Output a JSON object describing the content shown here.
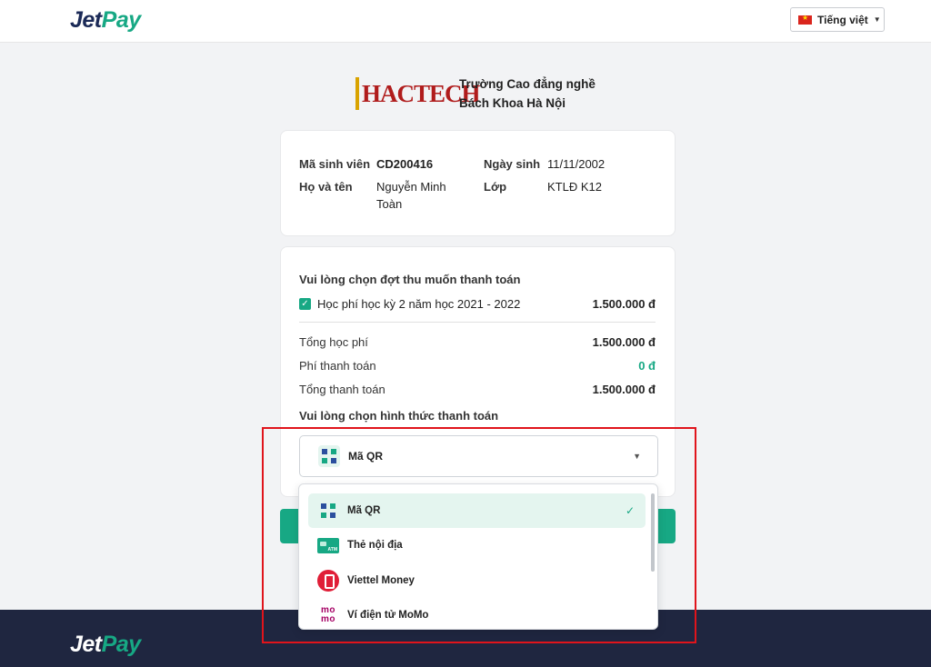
{
  "header": {
    "logo_jet": "Jet",
    "logo_pay": "Pay",
    "language": "Tiếng việt"
  },
  "school": {
    "logo_text": "HACTECH",
    "name_line1": "Trường Cao đẳng nghề",
    "name_line2": "Bách Khoa Hà Nội"
  },
  "student": {
    "id_label": "Mã sinh viên",
    "id_value": "CD200416",
    "dob_label": "Ngày sinh",
    "dob_value": "11/11/2002",
    "name_label": "Họ và tên",
    "name_value_line1": "Nguyễn Minh",
    "name_value_line2": "Toàn",
    "class_label": "Lớp",
    "class_value": "KTLĐ K12"
  },
  "payment": {
    "period_title": "Vui lòng chọn đợt thu muốn thanh toán",
    "period_item": "Học phí học kỳ 2 năm học 2021 - 2022",
    "period_amount": "1.500.000 đ",
    "period_checked": true,
    "total_fee_label": "Tổng học phí",
    "total_fee_value": "1.500.000 đ",
    "payment_fee_label": "Phí thanh toán",
    "payment_fee_value": "0 đ",
    "total_pay_label": "Tổng thanh toán",
    "total_pay_value": "1.500.000 đ",
    "method_title": "Vui lòng chọn hình thức thanh toán",
    "selected_method": "Mã QR",
    "method_icon": "qr-icon"
  },
  "dropdown": {
    "options": [
      {
        "label": "Mã QR",
        "icon": "qr-icon",
        "selected": true
      },
      {
        "label": "Thẻ nội địa",
        "icon": "atm-card-icon",
        "selected": false
      },
      {
        "label": "Viettel Money",
        "icon": "viettel-money-icon",
        "selected": false
      },
      {
        "label": "Ví điện tử MoMo",
        "icon": "momo-icon",
        "selected": false
      }
    ],
    "momo_icon_text_top": "mo",
    "momo_icon_text_bottom": "mo"
  },
  "footer": {
    "logo_jet": "Jet",
    "logo_pay": "Pay"
  },
  "colors": {
    "accent": "#17a884",
    "navy": "#1b2a57",
    "footer_bg": "#1f2640",
    "highlight": "#e0141b"
  }
}
